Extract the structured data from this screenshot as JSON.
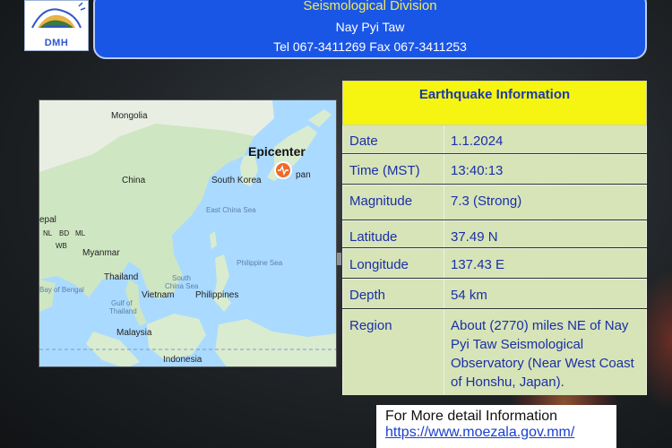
{
  "header": {
    "division": "Seismological Division",
    "city": "Nay Pyi Taw",
    "contact": "Tel 067-3411269 Fax 067-3411253"
  },
  "logo": {
    "text": "DMH"
  },
  "map": {
    "epicenter_label": "Epicenter",
    "places": {
      "mongolia": "Mongolia",
      "china": "China",
      "south_korea": "South Korea",
      "japan_partial": "pan",
      "east_china_sea": "East China Sea",
      "nepal_partial": "epal",
      "bd": "BD",
      "ml": "ML",
      "nl": "NL",
      "wb": "WB",
      "myanmar": "Myanmar",
      "philippine_sea": "Philippine Sea",
      "thailand": "Thailand",
      "south": "South",
      "china_sea": "China Sea",
      "bay_of_bengal": "Bay of Bengal",
      "vietnam": "Vietnam",
      "philippines": "Philippines",
      "gulf_of": "Gulf of",
      "thailand_gulf": "Thailand",
      "malaysia": "Malaysia",
      "indonesia": "Indonesia"
    }
  },
  "info": {
    "title": "Earthquake Information",
    "rows": [
      {
        "label": "Date",
        "value": "1.1.2024"
      },
      {
        "label": "Time (MST)",
        "value": "13:40:13"
      },
      {
        "label": "Magnitude",
        "value": "7.3 (Strong)"
      },
      {
        "label": "Latitude",
        "value": "37.49 N"
      },
      {
        "label": "Longitude",
        "value": "137.43 E"
      },
      {
        "label": "Depth",
        "value": "54 km"
      },
      {
        "label": "Region",
        "value": "About (2770) miles NE of Nay Pyi Taw Seismological Observatory (Near West Coast of Honshu, Japan)."
      }
    ]
  },
  "more": {
    "text": "For More detail Information",
    "link": "https://www.moezala.gov.mm/"
  },
  "colors": {
    "header_bg": "#1a56e6",
    "header_title": "#f3ea55",
    "table_title_bg": "#f5f511",
    "table_row_bg": "#d6e4b8",
    "table_text": "#1b2fa6",
    "epicenter": "#f06a2a"
  }
}
